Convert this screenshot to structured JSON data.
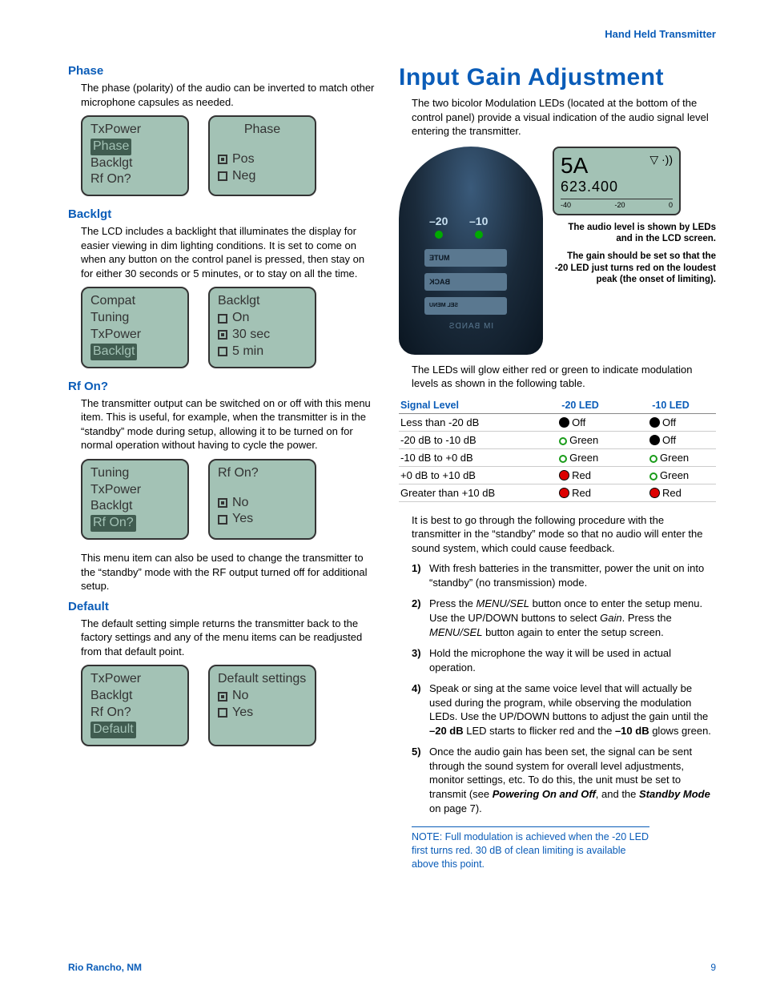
{
  "header": {
    "running": "Hand Held Transmitter"
  },
  "footer": {
    "location": "Rio Rancho, NM",
    "page": "9"
  },
  "left": {
    "phase": {
      "title": "Phase",
      "text": "The phase (polarity) of the audio can be inverted to match other microphone capsules as needed.",
      "menu": [
        "TxPower",
        "Phase",
        "Backlgt",
        "Rf On?"
      ],
      "menu_selected": 1,
      "opt_title": "Phase",
      "opts": [
        "Pos",
        "Neg"
      ],
      "opts_checked": 0
    },
    "backlgt": {
      "title": "Backlgt",
      "text": "The LCD includes a backlight that illuminates the display for easier viewing in dim lighting conditions. It is set to come on when any button on the control panel is pressed, then stay on for either 30 seconds or 5 minutes, or to stay on all the time.",
      "menu": [
        "Compat",
        "Tuning",
        "TxPower",
        "Backlgt"
      ],
      "menu_selected": 3,
      "opt_title": "Backlgt",
      "opts": [
        "On",
        "30 sec",
        "5 min"
      ],
      "opts_checked": 1
    },
    "rfon": {
      "title": "Rf On?",
      "text": "The transmitter output can be switched on or off with this menu item. This is useful, for example, when the transmitter is in the “standby” mode during setup, allowing it to be turned on for normal operation without having to cycle the power.",
      "menu": [
        "Tuning",
        "TxPower",
        "Backlgt",
        "Rf On?"
      ],
      "menu_selected": 3,
      "opt_title": "Rf On?",
      "opts": [
        "No",
        "Yes"
      ],
      "opts_checked": 0,
      "text2": "This menu item can also be used to change the transmitter to the “standby” mode with the RF output turned off for additional setup."
    },
    "def": {
      "title": "Default",
      "text": "The default setting simple returns the transmitter back to the factory settings and any of the menu items can be readjusted from that default point.",
      "menu": [
        "TxPower",
        "Backlgt",
        "Rf On?",
        "Default"
      ],
      "menu_selected": 3,
      "opt_title": "Default settings",
      "opts": [
        "No",
        "Yes"
      ],
      "opts_checked": 0
    }
  },
  "right": {
    "title": "Input Gain Adjustment",
    "intro": "The two bicolor Modulation LEDs (located at the bottom of the control panel) provide a visual indication of the audio signal level entering the transmitter.",
    "device": {
      "db20": "–20",
      "db10": "–10",
      "btn_mute": "MUTE",
      "btn_back": "BACK",
      "btn_sel": "SEL MENU",
      "brand": "IM BANDS"
    },
    "screen": {
      "group": "5A",
      "freq": "623.400",
      "m1": "-40",
      "m2": "-20",
      "m3": "0"
    },
    "caption1": "The audio level is shown by LEDs and in the LCD screen.",
    "caption2": "The gain should be set so that the -20 LED just turns red on the loudest peak (the onset of limiting).",
    "table_intro": "The LEDs will glow either red or green to indicate modulation levels as shown in the following table.",
    "table": {
      "h1": "Signal Level",
      "h2": "-20 LED",
      "h3": "-10 LED",
      "rows": [
        {
          "lvl": "Less than -20 dB",
          "c20": "off",
          "t20": "Off",
          "c10": "off",
          "t10": "Off"
        },
        {
          "lvl": "-20 dB to -10 dB",
          "c20": "g",
          "t20": "Green",
          "c10": "off",
          "t10": "Off"
        },
        {
          "lvl": "-10 dB to +0 dB",
          "c20": "g",
          "t20": "Green",
          "c10": "g",
          "t10": "Green"
        },
        {
          "lvl": "+0 dB to +10 dB",
          "c20": "r",
          "t20": "Red",
          "c10": "g",
          "t10": "Green"
        },
        {
          "lvl": "Greater than +10 dB",
          "c20": "r",
          "t20": "Red",
          "c10": "r",
          "t10": "Red"
        }
      ]
    },
    "proc_intro": "It is best to go through the following procedure with the transmitter in the “standby” mode so that no audio will enter the sound system, which could cause feedback.",
    "steps": {
      "s1": "With fresh batteries in the transmitter, power the unit on into “standby” (no transmission) mode.",
      "s2a": "Press the ",
      "s2i1": "MENU/SEL",
      "s2b": " button once to enter the setup menu. Use the UP/DOWN buttons to select ",
      "s2i2": "Gain",
      "s2c": ". Press the ",
      "s2i3": "MENU/SEL",
      "s2d": " button again to enter the setup screen.",
      "s3": "Hold the microphone the way it will be used in actual operation.",
      "s4a": "Speak or sing at the same voice level that will actually be used during the program, while observing the modulation LEDs. Use the UP/DOWN buttons to adjust the gain until the ",
      "s4b1": "–20 dB",
      "s4b": " LED starts to flicker red and the ",
      "s4b2": "–10 dB",
      "s4c": " glows green.",
      "s5a": "Once the audio gain has been set, the signal can be sent through the sound system for overall level adjustments, monitor settings, etc. To do this, the unit must be set to transmit (see ",
      "s5b1": "Powering On and Off",
      "s5b": ", and the ",
      "s5b2": "Standby Mode",
      "s5c": " on page 7)."
    },
    "note": "NOTE:  Full modulation is achieved when the -20 LED first turns red. 30 dB of clean limiting is available above this point."
  }
}
